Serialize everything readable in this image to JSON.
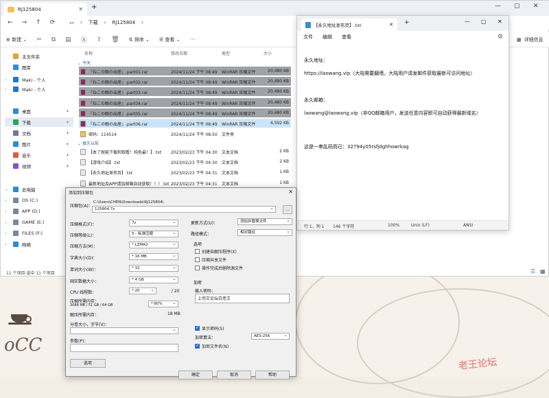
{
  "explorer": {
    "tab_title": "RJ125804",
    "nav": {
      "back": "←",
      "forward": "→",
      "up": "↑",
      "refresh": "⟳",
      "breadcrumb": [
        "下载",
        "RJ125804"
      ]
    },
    "cmd": {
      "new": "新建",
      "sort": "排序",
      "view": "查看",
      "details": "详细信息"
    },
    "sidebar": [
      {
        "label": "主文件夹",
        "icon": "home-icon",
        "color": "#e2a23a",
        "chev": ""
      },
      {
        "label": "图库",
        "icon": "gallery-icon",
        "color": "#3a86d4",
        "chev": ""
      },
      {
        "label": "Maki - 个人",
        "icon": "cloud-icon",
        "color": "#1f78d1",
        "chev": "›"
      },
      {
        "label": "Maki - 个人",
        "icon": "cloud-icon",
        "color": "#1f78d1",
        "chev": "›"
      },
      {
        "label": "桌面",
        "icon": "desktop-icon",
        "color": "#2b8ad6",
        "chev": "",
        "pin": "✦"
      },
      {
        "label": "下载",
        "icon": "download-icon",
        "color": "#2aa35a",
        "chev": "",
        "pin": "✦",
        "active": true
      },
      {
        "label": "文档",
        "icon": "documents-icon",
        "color": "#6b7c93",
        "chev": "",
        "pin": "✦"
      },
      {
        "label": "图片",
        "icon": "pictures-icon",
        "color": "#2b8ad6",
        "chev": "",
        "pin": "✦"
      },
      {
        "label": "音乐",
        "icon": "music-icon",
        "color": "#e25a3a",
        "chev": "",
        "pin": "✦"
      },
      {
        "label": "视频",
        "icon": "videos-icon",
        "color": "#8a4fd6",
        "chev": "",
        "pin": "✦"
      },
      {
        "label": "此电脑",
        "icon": "pc-icon",
        "color": "#2b8ad6",
        "chev": "⌄"
      },
      {
        "label": "OS (C:)",
        "icon": "drive-icon",
        "color": "#7a8899",
        "chev": "›"
      },
      {
        "label": "APP (D:)",
        "icon": "drive-icon",
        "color": "#7a8899",
        "chev": "›"
      },
      {
        "label": "GAME (E:)",
        "icon": "drive-icon",
        "color": "#7a8899",
        "chev": "›"
      },
      {
        "label": "FILES (F:)",
        "icon": "drive-icon",
        "color": "#7a8899",
        "chev": "›"
      },
      {
        "label": "网络",
        "icon": "network-icon",
        "color": "#2b8ad6",
        "chev": "›"
      }
    ],
    "columns": [
      "名称",
      "修改日期",
      "类型",
      "大小"
    ],
    "groups": [
      "今天",
      "很久以前"
    ],
    "files_today": [
      {
        "name": "『ねこの眼の出産』.part01.rar",
        "date": "2024/11/24 下午 08:49",
        "type": "WinRAR 压缩文件",
        "size": "20,480 KB",
        "style": "dark"
      },
      {
        "name": "『ねこの眼の出産』.part02.rar",
        "date": "2024/11/24 下午 08:49",
        "type": "WinRAR 压缩文件",
        "size": "20,480 KB",
        "style": "dark"
      },
      {
        "name": "『ねこの眼の出産』.part03.rar",
        "date": "2024/11/24 下午 08:49",
        "type": "WinRAR 压缩文件",
        "size": "20,480 KB",
        "style": "dark"
      },
      {
        "name": "『ねこの眼の出産』.part04.rar",
        "date": "2024/11/24 下午 08:49",
        "type": "WinRAR 压缩文件",
        "size": "20,480 KB",
        "style": "dark"
      },
      {
        "name": "『ねこの眼の出産』.part05.rar",
        "date": "2024/11/24 下午 08:49",
        "type": "WinRAR 压缩文件",
        "size": "20,480 KB",
        "style": "dark"
      },
      {
        "name": "『ねこの眼の出産』.part06.rar",
        "date": "2024/11/24 下午 08:49",
        "type": "WinRAR 压缩文件",
        "size": "4,592 KB",
        "style": "sel"
      },
      {
        "name": "密码：114514",
        "date": "2024/11/24 下午 08:50",
        "type": "文件夹",
        "size": "",
        "style": ""
      }
    ],
    "files_old": [
      {
        "name": "【本了就能下载和观看！纯色最！】.txt",
        "date": "2023/02/23 下午 04:30",
        "type": "文本文档",
        "size": "2 KB"
      },
      {
        "name": "【游戏介绍】.txt",
        "date": "2023/02/23 下午 04:30",
        "type": "文本文档",
        "size": "2 KB"
      },
      {
        "name": "【永久地址发布页】.txt",
        "date": "2023/02/23 下午 04:31",
        "type": "文本文档",
        "size": "1 KB"
      },
      {
        "name": "最新地址及APP请加邮箱自动获取！！！.txt",
        "date": "2023/02/23 下午 04:31",
        "type": "文本文档",
        "size": "1 KB"
      }
    ],
    "status": "11 个项目   选中 11 个项目"
  },
  "notepad": {
    "tab_title": "【永久地址发布页】.txt",
    "menu": [
      "文件",
      "编辑",
      "查看"
    ],
    "lines": [
      "永久地址：",
      "https://laowang.vip（大陆需要翻墙，大陆用户请发邮件获取最新可访问地址）",
      "永久邮箱：",
      "laowang@laowang.vip（非QQ邮箱用户，发送任意内容即可自动获得最新域名）",
      "这是一串乱码而已：32794y05rsfjdghhowrkag"
    ],
    "status": {
      "pos": "行 1，列 1",
      "chars": "146 个字符",
      "zoom": "100%",
      "eol": "Unix (LF)",
      "enc": "ANSI"
    }
  },
  "dialog": {
    "title": "添加到压缩包",
    "archive_label": "压缩包(A)：",
    "archive_path": "C:\\Users\\CHEN\\Downloads\\RJ125804\\",
    "archive_name": "125804.7z",
    "browse": "...",
    "fields": [
      {
        "label": "压缩格式(F)：",
        "value": "7z"
      },
      {
        "label": "压缩等级(L)：",
        "value": "5 - 标准压缩"
      },
      {
        "label": "压缩方法(M)：",
        "value": "* LZMA2"
      },
      {
        "label": "字典大小(D)：",
        "value": "* 16 MB"
      },
      {
        "label": "单词大小(W)：",
        "value": "* 32"
      },
      {
        "label": "固实数据大小：",
        "value": "* 4 GB"
      }
    ],
    "cpu_label": "CPU 线程数：",
    "cpu_value": "* 20",
    "cpu_total": "/ 20",
    "mem_label": "压缩所需内存：",
    "mem_detail": "3088 MB / 51 GB / 64 GB",
    "mem_pct": "* 80%",
    "decomp_label": "解压所需内存：",
    "decomp_value": "18 MB",
    "split_label": "分卷大小，字节(V)：",
    "param_label": "参数(P)：",
    "options_btn": "选项",
    "update_label": "更新方式(U)：",
    "update_value": "添加并替换文件",
    "pathmode_label": "路径模式：",
    "pathmode_value": "相对路径",
    "options_title": "选项",
    "options": [
      {
        "label": "创建自解压程序(X)",
        "on": false
      },
      {
        "label": "压缩共享文件",
        "on": false
      },
      {
        "label": "操作完成后删除源文件",
        "on": false
      }
    ],
    "encrypt_title": "加密",
    "pwd_label": "输入密码：",
    "pwd_value": "上司王论坛白老王",
    "show_pwd": "显示密码(S)",
    "enc_method_label": "加密算法：",
    "enc_method": "AES-256",
    "enc_names": "加密文件名(N)",
    "ok": "确定",
    "cancel": "取消",
    "help": "帮助"
  },
  "watermark": "老王论坛"
}
